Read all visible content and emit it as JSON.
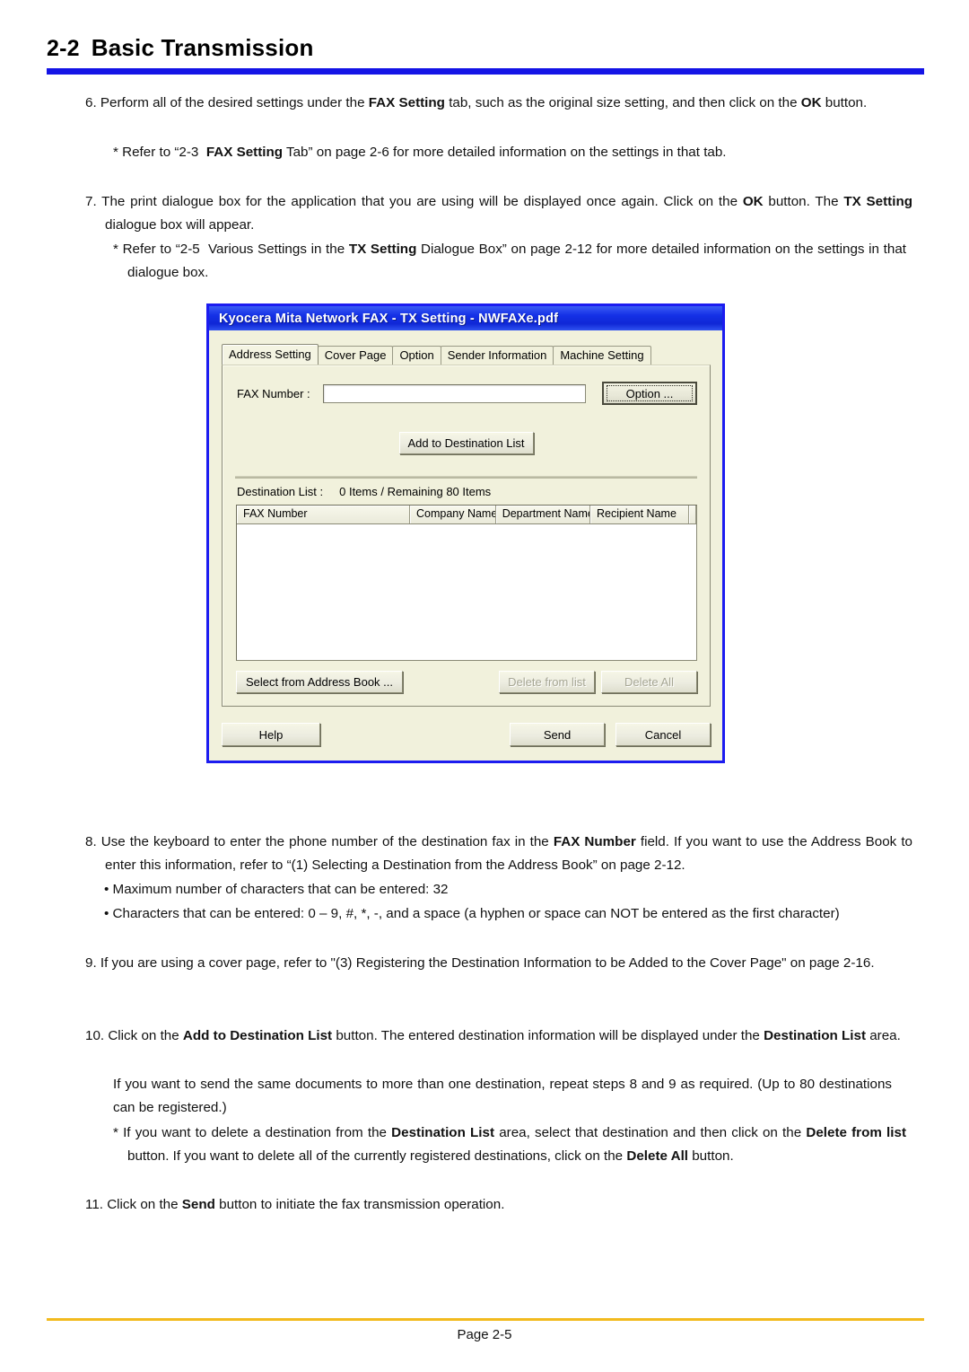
{
  "header": {
    "section_number": "2-2",
    "title": "Basic Transmission",
    "rule_color": "#1414e6"
  },
  "steps": {
    "step6": "6. Perform all of the desired settings under the <b>FAX Setting</b> tab, such as the original size setting, and then click on the <b>OK</b> button.",
    "step6_note": "* Refer to “2-3&nbsp; <b>FAX Setting</b> Tab” on page 2-6 for more detailed information on the settings in that tab.",
    "step7": "7. The print dialogue box for the application that you are using will be displayed once again. Click on the <b>OK</b> button. The <b>TX Setting</b> dialogue box will appear.",
    "step7_note": "* Refer to “2-5&nbsp; Various Settings in the <b>TX Setting</b> Dialogue Box” on page 2-12 for more detailed information on the settings in that dialogue box.",
    "step8": "8. Use the keyboard to enter the phone number of the destination fax in the <b>FAX Number</b> field. If you want to use the Address Book to enter this information, refer to “(1) Selecting a Destination from the Address Book” on page 2-12.",
    "step8_bullet1": "• Maximum number of characters that can be entered: 32",
    "step8_bullet2": "• Characters that can be entered: 0 – 9, #, *, -, and a space (a hyphen or space can NOT be entered as the first character)",
    "step9": "9. If you are using a cover page, refer to \"(3) Registering the Destination Information to be Added to the Cover Page\" on page 2-16.",
    "step10": "10. Click on the <b>Add to Destination List</b> button. The entered destination information will be displayed under the <b>Destination List</b> area.",
    "step10_cont": "If you want to send the same documents to more than one destination, repeat steps 8 and 9 as required. (Up to 80 destinations can be registered.)",
    "step10_note": "* If you want to delete a destination from the <b>Destination List</b> area, select that destination and then click on the <b>Delete from list</b> button. If you want to delete all of the currently registered destinations, click on the <b>Delete All</b> button.",
    "step11": "11. Click on the <b>Send</b> button to initiate the fax transmission operation."
  },
  "dialog": {
    "title": "Kyocera Mita Network FAX - TX Setting - NWFAXe.pdf",
    "frame_color": "#1c1cf0",
    "body_color": "#f1f1dc",
    "tabs": [
      {
        "label": "Address Setting",
        "active": true
      },
      {
        "label": "Cover Page",
        "active": false
      },
      {
        "label": "Option",
        "active": false
      },
      {
        "label": "Sender Information",
        "active": false
      },
      {
        "label": "Machine Setting",
        "active": false
      }
    ],
    "fax_number_label": "FAX Number :",
    "fax_number_value": "",
    "option_button": "Option ...",
    "add_to_list_button": "Add to Destination List",
    "destination_list_label": "Destination List :",
    "destination_list_count": "0 Items / Remaining 80 Items",
    "list_columns": [
      "FAX Number",
      "Company Name",
      "Department Name",
      "Recipient Name",
      ""
    ],
    "list_rows": [],
    "select_address_book_button": "Select from Address Book ...",
    "delete_from_list_button": "Delete from list",
    "delete_all_button": "Delete All",
    "help_button": "Help",
    "send_button": "Send",
    "cancel_button": "Cancel"
  },
  "footer": {
    "page_label": "Page 2-5",
    "rule_color": "#f2ba1e"
  }
}
